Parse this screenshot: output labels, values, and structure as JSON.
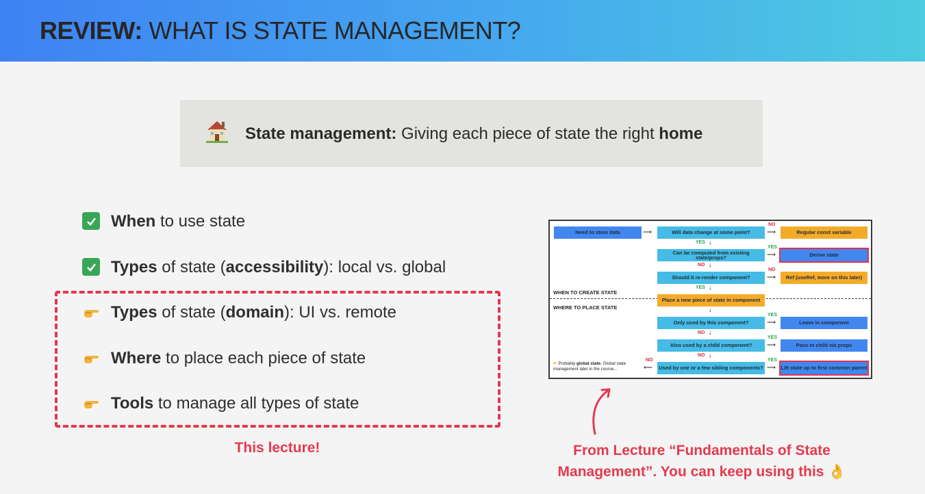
{
  "header": {
    "title_bold": "REVIEW:",
    "title_rest": " WHAT IS STATE MANAGEMENT?",
    "gradient_start": "#3f82f3",
    "gradient_end": "#4dcbe0"
  },
  "definition": {
    "icon": "house-icon",
    "bold": "State management:",
    "text": " Giving each piece of state the right ",
    "emphasis": "home"
  },
  "list": [
    {
      "icon": "check-icon",
      "bold": "When",
      "text": " to use state"
    },
    {
      "icon": "check-icon",
      "bold": "Types",
      "text": " of state (",
      "bold2": "accessibility",
      "text2": "): local vs. global"
    },
    {
      "icon": "pointing-hand-icon",
      "bold": "Types",
      "text": " of state (",
      "bold2": "domain",
      "text2": "): UI vs. remote"
    },
    {
      "icon": "pointing-hand-icon",
      "bold": "Where",
      "text": " to place each piece of state"
    },
    {
      "icon": "pointing-hand-icon",
      "bold": "Tools",
      "text": " to manage all types of state"
    }
  ],
  "this_lecture_note": "This lecture!",
  "source_note": {
    "line1": "From Lecture “Fundamentals of State",
    "line2": "Management”. You can keep using this 👌"
  },
  "accent_red": "#e43a4f",
  "flowchart": {
    "start": "Need to store data",
    "q1": "Will data change at some point?",
    "a1": "Regular const variable",
    "q2": "Can be computed from existing state/props?",
    "a2": "Derive state",
    "q3": "Should it re-render component?",
    "a3": "Ref (useRef, more on this later)",
    "create_label": "WHEN TO CREATE STATE",
    "place_label": "WHERE TO PLACE STATE",
    "create": "Place a new piece of state in component",
    "q4": "Only used by this component?",
    "a4": "Leave in component",
    "q5": "Also used by a child component?",
    "a5": "Pass to child via props",
    "q6": "Used by one or a few sibling components?",
    "a6": "Lift state up to first common parent",
    "global_note_pre": "Probably ",
    "global_note_bold": "global state.",
    "global_note_post": " Global state management later in the course...",
    "yes": "YES",
    "no": "NO"
  }
}
